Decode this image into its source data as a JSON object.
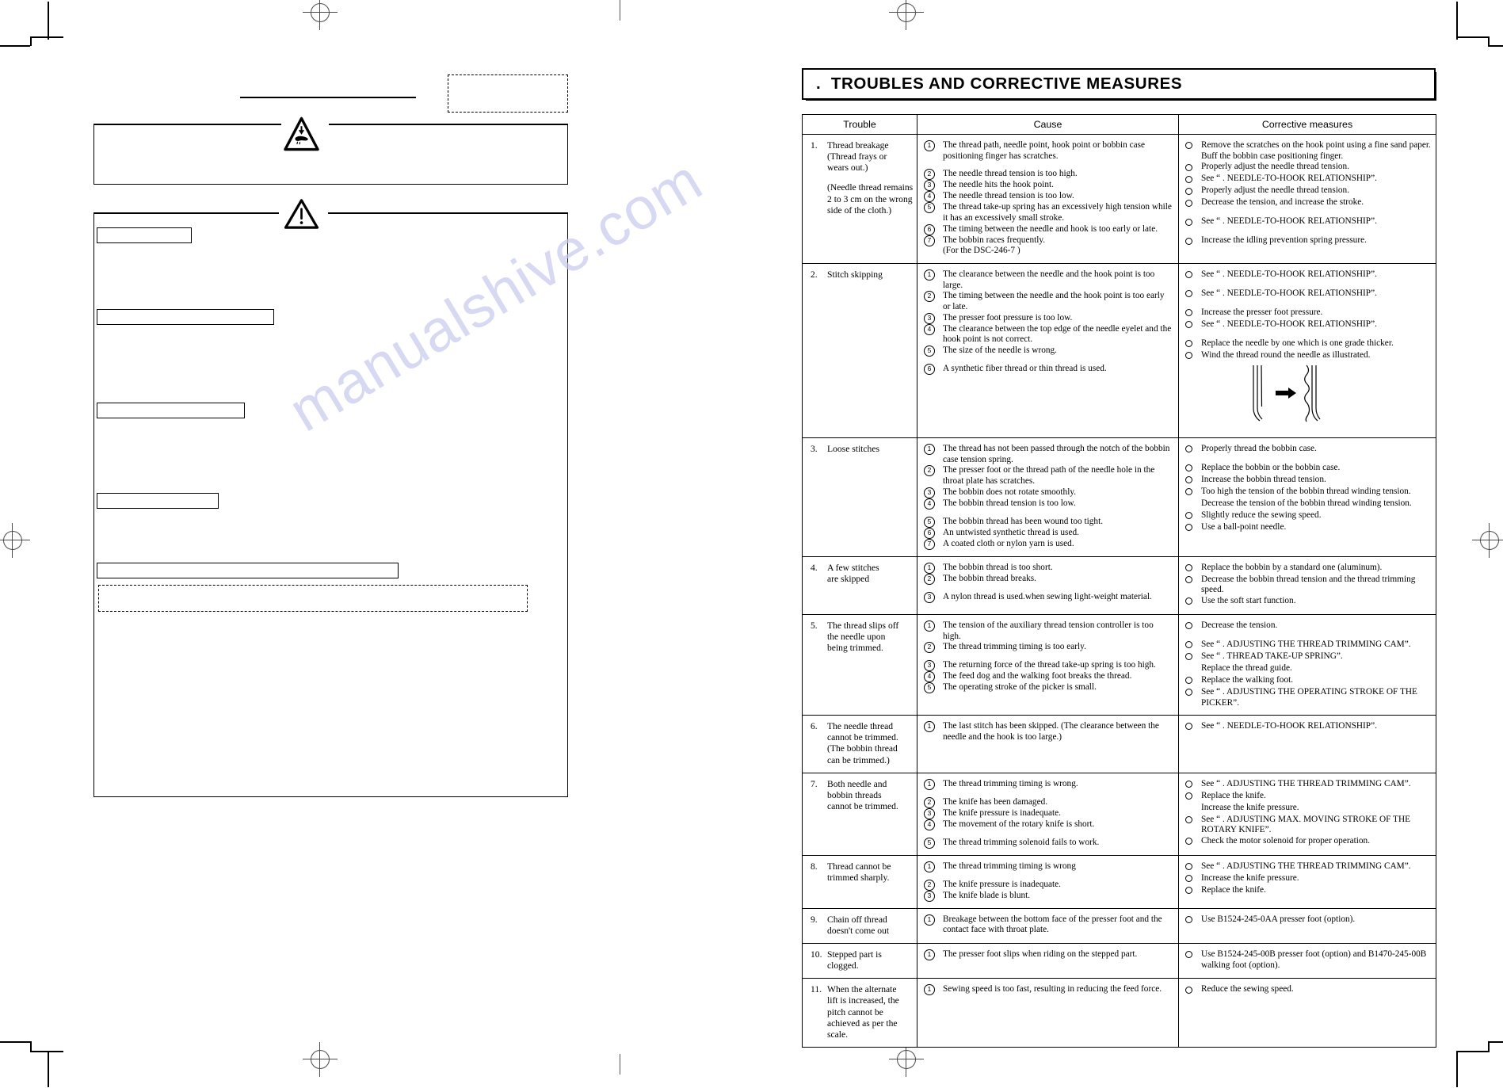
{
  "right_page": {
    "section_title": ".  TROUBLES AND CORRECTIVE MEASURES",
    "table": {
      "headers": [
        "Trouble",
        "Cause",
        "Corrective measures"
      ],
      "rows": [
        {
          "num": "1.",
          "trouble": "Thread breakage\n(Thread frays or\nwears out.)",
          "trouble_sub": "(Needle thread remains\n2 to 3 cm on the wrong\nside of the cloth.)",
          "causes": [
            {
              "mark": "1",
              "text": "The thread path, needle point, hook point or bobbin case positioning finger has scratches.",
              "gap": false
            },
            {
              "mark": "2",
              "text": "The needle thread tension is too high.",
              "gap": true
            },
            {
              "mark": "3",
              "text": "The needle hits the hook point.",
              "gap": false
            },
            {
              "mark": "4",
              "text": "The needle thread tension is too low.",
              "gap": false
            },
            {
              "mark": "5",
              "text": "The thread take-up spring has an excessively high tension while it has an excessively small stroke.",
              "gap": false
            },
            {
              "mark": "6",
              "text": "The timing between the needle and hook is too early or late.",
              "gap": false
            },
            {
              "mark": "7",
              "text": "The bobbin races frequently.\n(For the DSC-246-7 )",
              "gap": false
            }
          ],
          "measures": [
            {
              "text": "Remove the scratches on the hook point using a fine sand paper.  Buff the bobbin case positioning finger.",
              "gap": false
            },
            {
              "text": "Properly adjust the needle thread tension.",
              "gap": false
            },
            {
              "text": "See “   . NEEDLE-TO-HOOK RELATIONSHIP”.",
              "gap": false
            },
            {
              "text": "Properly adjust the needle thread tension.",
              "gap": false
            },
            {
              "text": "Decrease the tension, and increase the stroke.",
              "gap": false
            },
            {
              "text": "See “   . NEEDLE-TO-HOOK RELATIONSHIP”.",
              "gap": true
            },
            {
              "text": "Increase the idling prevention spring pressure.",
              "gap": true
            }
          ]
        },
        {
          "num": "2.",
          "trouble": "Stitch skipping",
          "trouble_sub": "",
          "causes": [
            {
              "mark": "1",
              "text": "The clearance between the needle and the hook point is too large.",
              "gap": false
            },
            {
              "mark": "2",
              "text": "The timing between the needle and the hook point is too early or late.",
              "gap": false
            },
            {
              "mark": "3",
              "text": "The presser foot pressure is too low.",
              "gap": false
            },
            {
              "mark": "4",
              "text": "The clearance between the top edge of the needle eyelet and the hook point is not correct.",
              "gap": false
            },
            {
              "mark": "5",
              "text": "The size of the needle is wrong.",
              "gap": false
            },
            {
              "mark": "6",
              "text": "A synthetic fiber thread or thin thread is used.",
              "gap": true
            }
          ],
          "measures": [
            {
              "text": "See “   . NEEDLE-TO-HOOK RELATIONSHIP”.",
              "gap": false
            },
            {
              "text": "See “   . NEEDLE-TO-HOOK RELATIONSHIP”.",
              "gap": true
            },
            {
              "text": "Increase the presser foot pressure.",
              "gap": true
            },
            {
              "text": "See “   . NEEDLE-TO-HOOK RELATIONSHIP”.",
              "gap": false
            },
            {
              "text": "Replace the needle by one which is one grade thicker.",
              "gap": true
            },
            {
              "text": "Wind the thread round the needle as illustrated.",
              "gap": false
            }
          ],
          "has_illustration": true
        },
        {
          "num": "3.",
          "trouble": "Loose stitches",
          "trouble_sub": "",
          "causes": [
            {
              "mark": "1",
              "text": "The thread has not been passed through the notch of the bobbin case tension spring.",
              "gap": false
            },
            {
              "mark": "2",
              "text": "The presser foot or the thread path of the needle hole in the throat plate has scratches.",
              "gap": false
            },
            {
              "mark": "3",
              "text": "The bobbin does not rotate smoothly.",
              "gap": false
            },
            {
              "mark": "4",
              "text": "The bobbin thread tension is too low.",
              "gap": false
            },
            {
              "mark": "5",
              "text": "The bobbin thread has been wound too tight.",
              "gap": true
            },
            {
              "mark": "6",
              "text": "An untwisted synthetic thread is used.",
              "gap": false
            },
            {
              "mark": "7",
              "text": "A coated cloth or nylon yarn is used.",
              "gap": false
            }
          ],
          "measures": [
            {
              "text": "Properly thread the bobbin case.",
              "gap": false
            },
            {
              "text": "Replace the bobbin or the bobbin case.",
              "gap": true
            },
            {
              "text": "Increase the bobbin thread tension.",
              "gap": false
            },
            {
              "text": "Too high the tension of the bobbin thread winding tension.",
              "gap": false
            },
            {
              "text": "Decrease the tension of the bobbin thread winding tension.",
              "gap": false,
              "no_mark": true
            },
            {
              "text": "Slightly reduce the sewing speed.",
              "gap": false
            },
            {
              "text": "Use a ball-point needle.",
              "gap": false
            }
          ]
        },
        {
          "num": "4.",
          "trouble": "A few stitches\nare skipped",
          "trouble_sub": "",
          "causes": [
            {
              "mark": "1",
              "text": "The bobbin thread is too short.",
              "gap": false
            },
            {
              "mark": "2",
              "text": "The bobbin thread breaks.",
              "gap": false
            },
            {
              "mark": "3",
              "text": "A nylon thread is used.when sewing light-weight material.",
              "gap": true
            }
          ],
          "measures": [
            {
              "text": "Replace the bobbin by a standard one (aluminum).",
              "gap": false
            },
            {
              "text": "Decrease the bobbin thread tension and the thread trimming speed.",
              "gap": false
            },
            {
              "text": "Use the soft start function.",
              "gap": false
            }
          ]
        },
        {
          "num": "5.",
          "trouble": "The thread slips off\nthe needle upon\nbeing trimmed.",
          "trouble_sub": "",
          "causes": [
            {
              "mark": "1",
              "text": "The tension of the auxiliary thread tension controller is too high.",
              "gap": false
            },
            {
              "mark": "2",
              "text": "The thread trimming timing is too early.",
              "gap": false
            },
            {
              "mark": "3",
              "text": "The returning force of the thread take-up spring is too high.",
              "gap": true
            },
            {
              "mark": "4",
              "text": "The feed dog and the walking foot breaks the thread.",
              "gap": false
            },
            {
              "mark": "5",
              "text": "The operating stroke of the picker is small.",
              "gap": false
            }
          ],
          "measures": [
            {
              "text": "Decrease the tension.",
              "gap": false
            },
            {
              "text": "See “   . ADJUSTING THE THREAD TRIMMING CAM”.",
              "gap": true
            },
            {
              "text": "See “   . THREAD TAKE-UP SPRING”.",
              "gap": false
            },
            {
              "text": "Replace the thread guide.",
              "gap": false,
              "no_mark": true
            },
            {
              "text": "Replace the walking foot.",
              "gap": false
            },
            {
              "text": "See “   . ADJUSTING THE OPERATING STROKE OF THE PICKER”.",
              "gap": false
            }
          ]
        },
        {
          "num": "6.",
          "trouble": "The needle thread\ncannot be trimmed.\n(The bobbin thread\ncan be trimmed.)",
          "trouble_sub": "",
          "causes": [
            {
              "mark": "1",
              "text": "The last stitch has been skipped.  (The clearance between the needle and the hook is too large.)",
              "gap": false
            }
          ],
          "measures": [
            {
              "text": "See “   . NEEDLE-TO-HOOK RELATIONSHIP”.",
              "gap": false
            }
          ]
        },
        {
          "num": "7.",
          "trouble": "Both needle and\nbobbin threads\ncannot be trimmed.",
          "trouble_sub": "",
          "causes": [
            {
              "mark": "1",
              "text": "The thread trimming timing is wrong.",
              "gap": false
            },
            {
              "mark": "2",
              "text": "The knife has been damaged.",
              "gap": true
            },
            {
              "mark": "3",
              "text": "The knife pressure is inadequate.",
              "gap": false
            },
            {
              "mark": "4",
              "text": "The movement of the rotary knife is short.",
              "gap": false
            },
            {
              "mark": "5",
              "text": "The thread trimming solenoid fails to work.",
              "gap": true
            }
          ],
          "measures": [
            {
              "text": "See “   . ADJUSTING THE THREAD TRIMMING CAM”.",
              "gap": false
            },
            {
              "text": "Replace the knife.",
              "gap": false
            },
            {
              "text": "Increase the knife pressure.",
              "gap": false,
              "no_mark": true
            },
            {
              "text": "See “   . ADJUSTING MAX. MOVING STROKE OF THE ROTARY KNIFE”.",
              "gap": false
            },
            {
              "text": "Check the motor solenoid for proper operation.",
              "gap": false
            }
          ]
        },
        {
          "num": "8.",
          "trouble": "Thread cannot be\ntrimmed sharply.",
          "trouble_sub": "",
          "causes": [
            {
              "mark": "1",
              "text": "The thread trimming timing is wrong",
              "gap": false
            },
            {
              "mark": "2",
              "text": "The knife pressure is inadequate.",
              "gap": true
            },
            {
              "mark": "3",
              "text": "The knife blade is blunt.",
              "gap": false
            }
          ],
          "measures": [
            {
              "text": "See “   . ADJUSTING THE THREAD TRIMMING CAM”.",
              "gap": false
            },
            {
              "text": "Increase the knife pressure.",
              "gap": false
            },
            {
              "text": "Replace the knife.",
              "gap": false
            }
          ]
        },
        {
          "num": "9.",
          "trouble": "Chain off thread\ndoesn't come out",
          "trouble_sub": "",
          "causes": [
            {
              "mark": "1",
              "text": "Breakage between the bottom face of the presser foot and the contact face with throat plate.",
              "gap": false
            }
          ],
          "measures": [
            {
              "text": "Use B1524-245-0AA presser foot (option).",
              "gap": false
            }
          ]
        },
        {
          "num": "10.",
          "trouble": "Stepped part is\nclogged.",
          "trouble_sub": "",
          "causes": [
            {
              "mark": "1",
              "text": "The presser foot slips when riding on the stepped part.",
              "gap": false
            }
          ],
          "measures": [
            {
              "text": "Use B1524-245-00B presser foot (option) and B1470-245-00B walking foot (option).",
              "gap": false
            }
          ]
        },
        {
          "num": "11.",
          "trouble": "When the alternate\nlift is increased, the\npitch cannot be\nachieved as per the\nscale.",
          "trouble_sub": "",
          "causes": [
            {
              "mark": "1",
              "text": "Sewing speed is too fast, resulting in reducing the feed force.",
              "gap": false
            }
          ],
          "measures": [
            {
              "text": "Reduce the sewing speed.",
              "gap": false
            }
          ]
        }
      ]
    }
  },
  "watermark": {
    "text": "manualshive.com",
    "color": "#c9cbee"
  },
  "left_page": {
    "note": "blank form page with warning symbols and empty ruled boxes"
  }
}
